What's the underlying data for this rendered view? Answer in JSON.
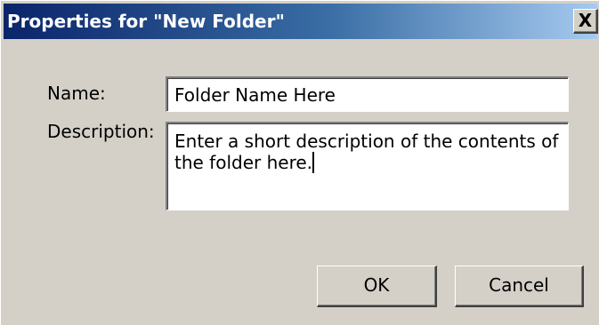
{
  "dialog": {
    "title": "Properties for \"New Folder\"",
    "close_label": "X"
  },
  "form": {
    "name_label": "Name:",
    "name_value": "Folder Name Here",
    "description_label": "Description:",
    "description_value": "Enter a short description of the contents of the folder here."
  },
  "buttons": {
    "ok_label": "OK",
    "cancel_label": "Cancel"
  },
  "colors": {
    "title_gradient_start": "#0a246a",
    "title_gradient_end": "#a6caf0",
    "dialog_bg": "#d4d0c8"
  }
}
